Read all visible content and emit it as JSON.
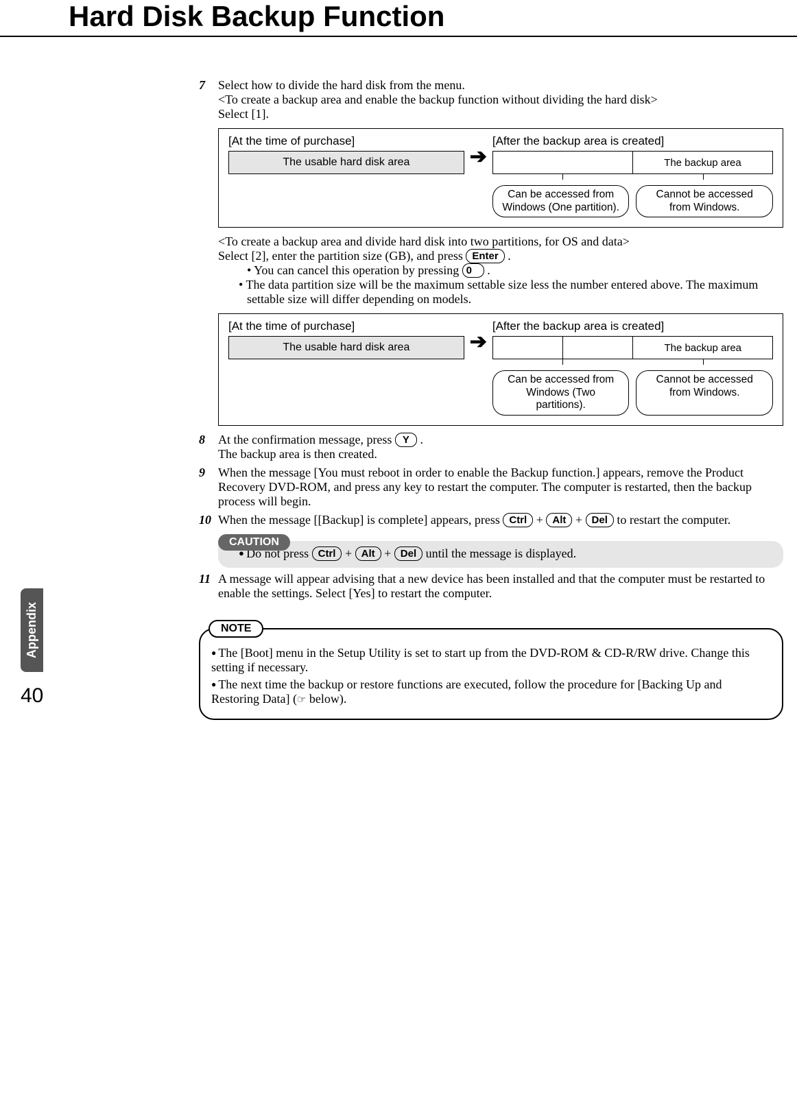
{
  "header": {
    "title": "Hard Disk Backup Function"
  },
  "sideTab": "Appendix",
  "pageNumber": "40",
  "step7": {
    "num": "7",
    "line1": "Select how to divide the hard disk from the menu.",
    "line2": "<To create a backup area and enable the backup function without dividing the hard disk>",
    "line3": "Select [1].",
    "line4": "<To create a backup area and divide hard disk into two partitions, for OS and data>",
    "line5a": "Select [2], enter the partition size (GB), and press ",
    "line5b": " .",
    "sub1a": "You can cancel this operation by pressing ",
    "sub1b": " .",
    "sub2": "The data partition size will be the maximum settable size less the number entered above. The maximum settable size will differ depending on models."
  },
  "keys": {
    "enter": "Enter",
    "zero": "0",
    "y": "Y",
    "ctrl": "Ctrl",
    "alt": "Alt",
    "del": "Del"
  },
  "diagram": {
    "purchaseLabel": "[At the time of purchase]",
    "afterLabel": "[After the backup area is created]",
    "usable": "The usable hard disk area",
    "backup": "The backup area",
    "bubOne": "Can be accessed from Windows (One partition).",
    "bubTwo": "Can be accessed from Windows (Two partitions).",
    "bubNo": "Cannot be accessed from Windows."
  },
  "step8": {
    "num": "8",
    "a": "At the confirmation message, press ",
    "b": " .",
    "c": "The backup area is then created."
  },
  "step9": {
    "num": "9",
    "text": "When the message [You must reboot in order to enable the Backup function.] appears, remove the Product Recovery DVD-ROM, and press any key to restart the computer. The computer is restarted, then the backup process will begin."
  },
  "step10": {
    "num": "10",
    "a": "When the message [[Backup] is complete] appears, press ",
    "b": " to restart the computer."
  },
  "caution": {
    "label": "CAUTION",
    "a": "Do not press ",
    "b": " until the message is displayed."
  },
  "step11": {
    "num": "11",
    "text": "A message will appear advising that a new device has been installed and that the computer must be restarted to enable the settings.  Select [Yes] to restart the computer."
  },
  "note": {
    "label": "NOTE",
    "item1": "The [Boot] menu in the Setup Utility is set to start up from the DVD-ROM & CD-R/RW drive. Change this setting if necessary.",
    "item2a": "The next time the backup or restore functions are executed, follow the procedure for [Backing Up and Restoring Data] (",
    "item2b": " below)."
  },
  "plus": "+",
  "handIcon": "☞"
}
